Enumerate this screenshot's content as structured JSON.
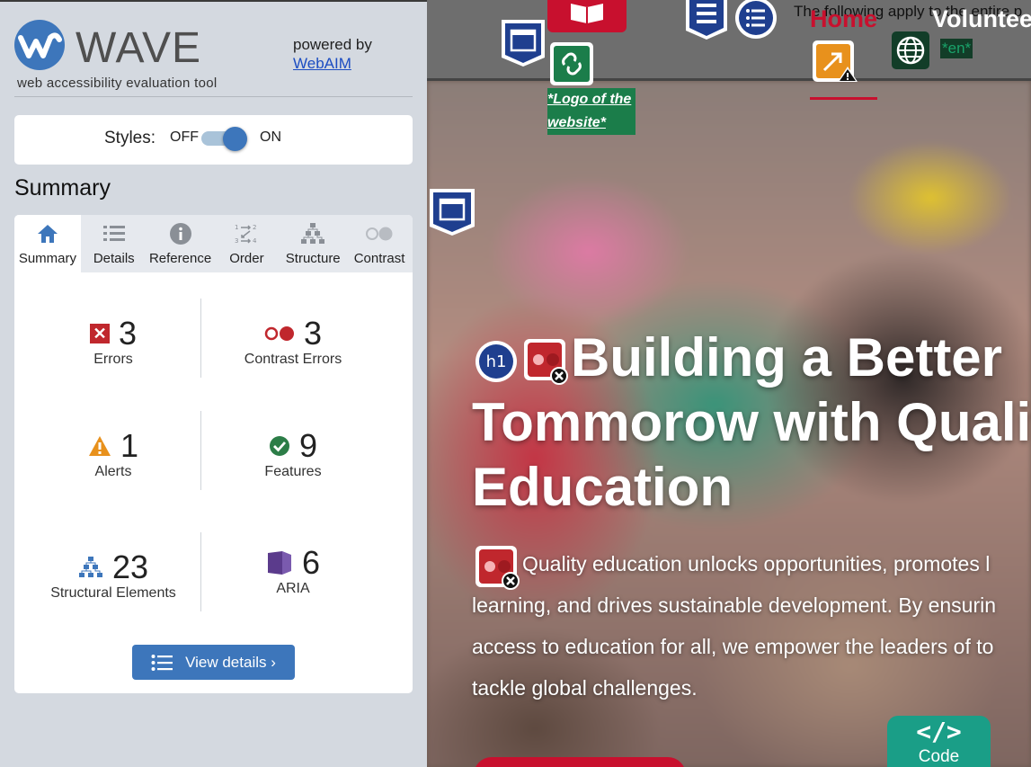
{
  "sidebar": {
    "brand": {
      "name": "WAVE",
      "tagline": "web accessibility evaluation tool",
      "powered_by": "powered by",
      "powered_link": "WebAIM"
    },
    "styles": {
      "label": "Styles:",
      "off": "OFF",
      "on": "ON",
      "state": "on"
    },
    "summary_heading": "Summary",
    "tabs": [
      {
        "label": "Summary",
        "icon": "home-icon",
        "active": true
      },
      {
        "label": "Details",
        "icon": "list-icon",
        "active": false
      },
      {
        "label": "Reference",
        "icon": "info-icon",
        "active": false
      },
      {
        "label": "Order",
        "icon": "order-icon",
        "active": false
      },
      {
        "label": "Structure",
        "icon": "hierarchy-icon",
        "active": false
      },
      {
        "label": "Contrast",
        "icon": "contrast-icon",
        "active": false
      }
    ],
    "stats": {
      "errors": {
        "count": "3",
        "label": "Errors"
      },
      "contrast_errors": {
        "count": "3",
        "label": "Contrast Errors"
      },
      "alerts": {
        "count": "1",
        "label": "Alerts"
      },
      "features": {
        "count": "9",
        "label": "Features"
      },
      "structural": {
        "count": "23",
        "label": "Structural Elements"
      },
      "aria": {
        "count": "6",
        "label": "ARIA"
      }
    },
    "view_details": "View details ›"
  },
  "preview": {
    "top_note": "The following apply to the entire p",
    "nav_home": "Home",
    "nav_volunteer": "Voluntee",
    "lang_tag": "*en*",
    "logo_alt": "*Logo of the website*",
    "hero_title_line1": "Building a Better",
    "hero_title_line2": "Tommorow with Quality",
    "hero_title_line3": "Education",
    "hero_text_line1": "Quality education unlocks opportunities, promotes l",
    "hero_text_line2": "learning, and drives sustainable development. By ensurin",
    "hero_text_line3": "access to education for all, we empower the leaders of to",
    "hero_text_line4": "tackle global challenges.",
    "code_symbol": "</>",
    "code_label": "Code",
    "h1_badge": "h1"
  },
  "colors": {
    "wave_blue": "#3d76bb",
    "error_red": "#c0272d",
    "alert_orange": "#e8911c",
    "feature_green": "#2c7d47",
    "aria_purple": "#5b3b8c",
    "nav_red": "#c8102e",
    "code_teal": "#1a9e87"
  }
}
